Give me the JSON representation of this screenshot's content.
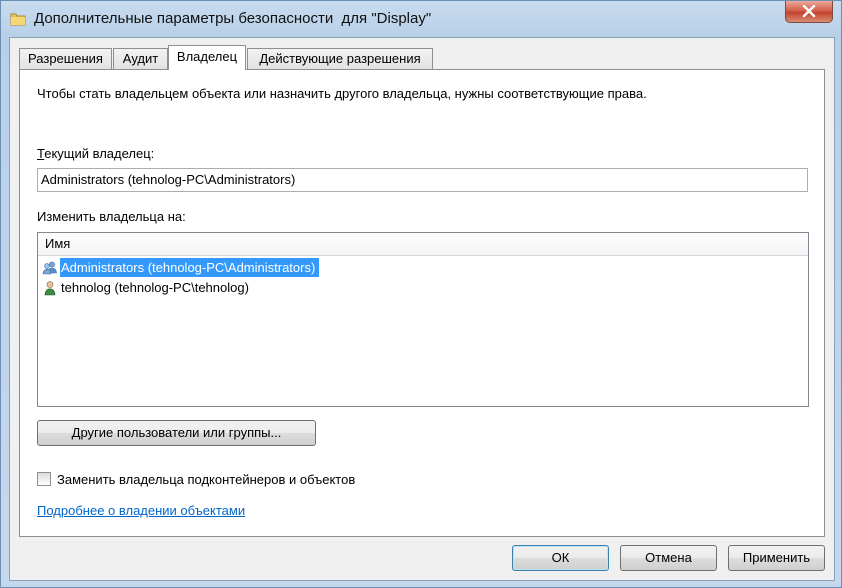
{
  "window": {
    "title": "Дополнительные параметры безопасности  для \"Display\"",
    "folder_icon": "folder-icon",
    "close_icon": "close-icon"
  },
  "tabs": [
    {
      "label": "Разрешения",
      "active": false
    },
    {
      "label": "Аудит",
      "active": false
    },
    {
      "label": "Владелец",
      "active": true
    },
    {
      "label": "Действующие разрешения",
      "active": false
    }
  ],
  "owner_tab": {
    "intro": "Чтобы стать владельцем объекта или назначить другого владельца, нужны соответствующие права.",
    "current_owner_label": "Текущий владелец:",
    "current_owner_value": "Administrators (tehnolog-PC\\Administrators)",
    "change_owner_label": "Изменить владельца на:",
    "list": {
      "column_header": "Имя",
      "rows": [
        {
          "name": "Administrators (tehnolog-PC\\Administrators)",
          "icon": "user-group-icon",
          "selected": true
        },
        {
          "name": "tehnolog (tehnolog-PC\\tehnolog)",
          "icon": "user-icon",
          "selected": false
        }
      ]
    },
    "other_users_button": "Другие пользователи или группы...",
    "replace_owner_checkbox": {
      "label": "Заменить владельца подконтейнеров и объектов",
      "checked": false
    },
    "learn_more_link": "Подробнее о владении объектами"
  },
  "footer": {
    "ok": "ОК",
    "cancel": "Отмена",
    "apply": "Применить"
  },
  "colors": {
    "selection": "#3399ff",
    "link": "#0066cc",
    "close_button": "#c2432f"
  }
}
